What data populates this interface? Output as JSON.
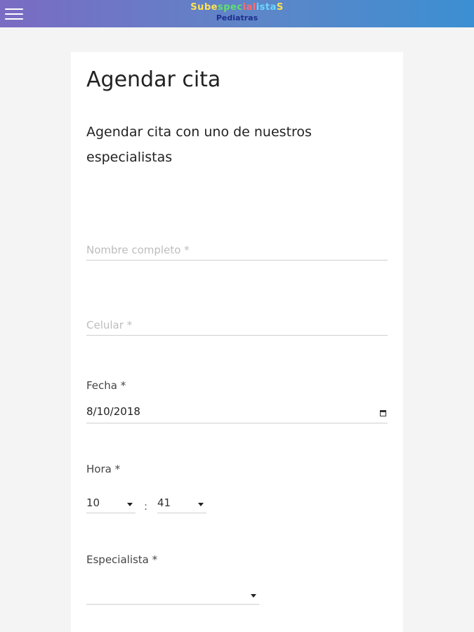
{
  "header": {
    "menu_icon": "hamburger-menu-icon",
    "logo": {
      "title_parts": [
        "Sube",
        "spec",
        "ial",
        "ista",
        "S"
      ],
      "title": "SubespecialistaS",
      "subtitle": "Pediatras",
      "colors": [
        "#ffe34d",
        "#5fe06b",
        "#ff6b6b",
        "#6ad7ff",
        "#ffe34d"
      ]
    },
    "gradient": [
      "#7a6bc3",
      "#3b8fd2"
    ]
  },
  "form": {
    "title": "Agendar cita",
    "subtitle": "Agendar cita con uno de nuestros especialistas",
    "nombre": {
      "placeholder": "Nombre completo *",
      "value": ""
    },
    "celular": {
      "placeholder": "Celular *",
      "value": ""
    },
    "fecha": {
      "label": "Fecha *",
      "value": "8/10/2018",
      "icon": "calendar-icon"
    },
    "hora": {
      "label": "Hora *",
      "hour": "10",
      "separator": ":",
      "minute": "41"
    },
    "especialista": {
      "label": "Especialista *",
      "value": ""
    }
  }
}
